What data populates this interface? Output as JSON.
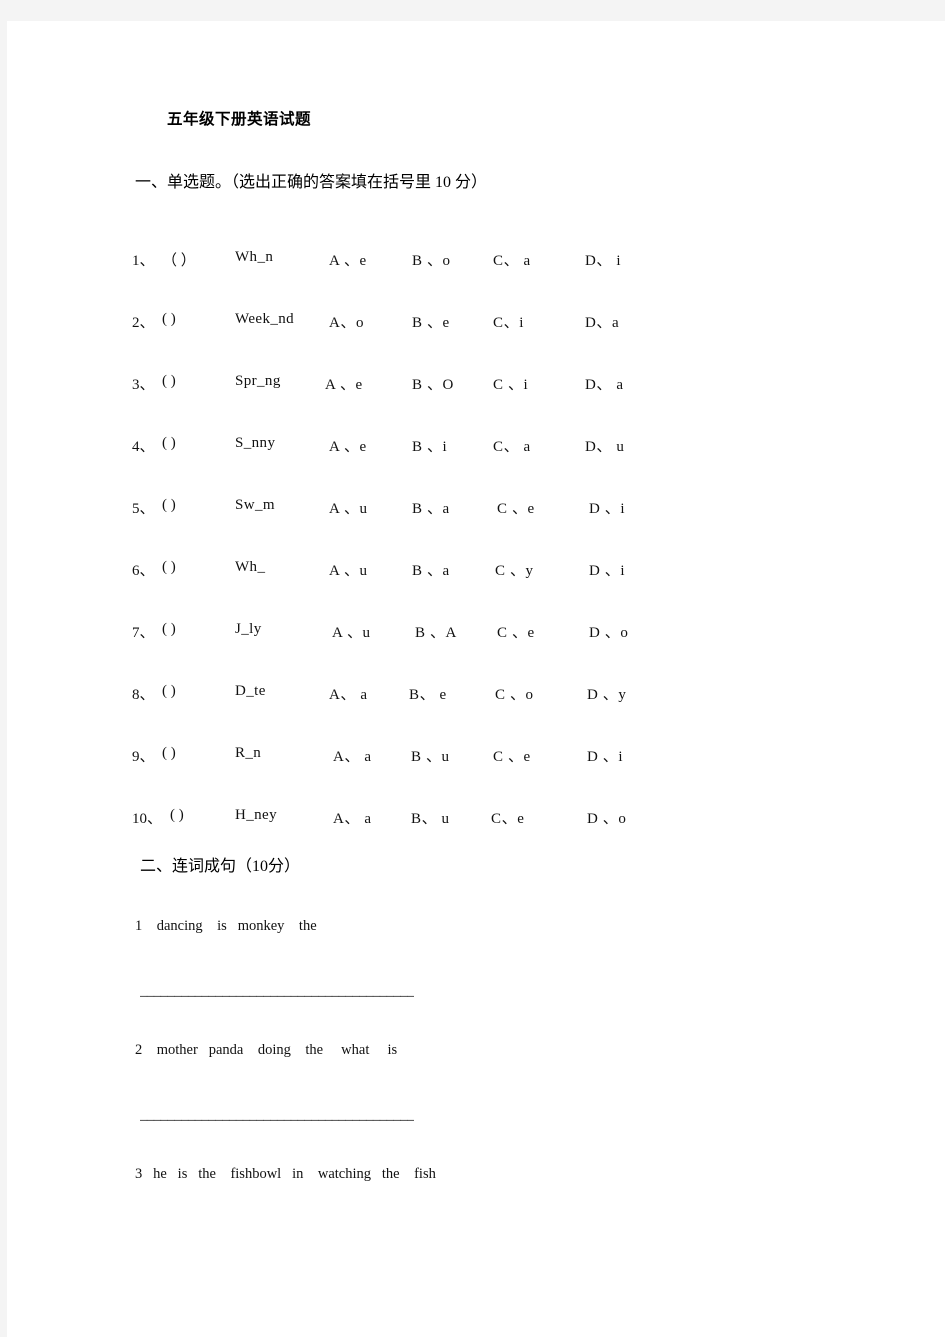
{
  "document": {
    "title": "五年级下册英语试题"
  },
  "sections": [
    {
      "heading": "一、单选题。（选出正确的答案填在括号里 10 分）"
    },
    {
      "heading": "二、连词成句（10分）"
    }
  ],
  "multiple_choice": [
    {
      "no": "1、",
      "paren": "（    ）",
      "word": "Wh_n",
      "a": "A 、e",
      "b": "B 、o",
      "c": "C、 a",
      "d": "D、 i"
    },
    {
      "no": "2、",
      "paren": "(    )",
      "word": "Week_nd",
      "a": "A、o",
      "b": "B 、e",
      "c": "C、i",
      "d": "D、a"
    },
    {
      "no": "3、",
      "paren": "(    )",
      "word": "Spr_ng",
      "a": "A 、e",
      "b": "B 、O",
      "c": "C 、i",
      "d": "D、 a"
    },
    {
      "no": "4、",
      "paren": "(    )",
      "word": "S_nny",
      "a": "A 、e",
      "b": "B 、i",
      "c": "C、 a",
      "d": "D、 u"
    },
    {
      "no": "5、",
      "paren": "(    )",
      "word": "Sw_m",
      "a": "A 、u",
      "b": "B 、a",
      "c": "C 、e",
      "d": "D 、i"
    },
    {
      "no": "6、",
      "paren": "(    )",
      "word": "Wh_",
      "a": "A 、u",
      "b": "B 、a",
      "c": "C 、y",
      "d": "D 、i"
    },
    {
      "no": "7、",
      "paren": "(    )",
      "word": "J_ly",
      "a": "A 、u",
      "b": "B 、A",
      "c": "C 、e",
      "d": "D 、o"
    },
    {
      "no": "8、",
      "paren": "(    )",
      "word": "D_te",
      "a": "A、 a",
      "b": "B、 e",
      "c": "C 、o",
      "d": "D 、y"
    },
    {
      "no": "9、",
      "paren": "(    )",
      "word": "R_n",
      "a": "A、 a",
      "b": "B 、u",
      "c": "C 、e",
      "d": "D 、i"
    },
    {
      "no": "10、",
      "paren": "(    )",
      "word": "H_ney",
      "a": "A、 a",
      "b": "B、  u",
      "c": "C、e",
      "d": "D 、o"
    }
  ],
  "sentence_items": [
    {
      "no": "1",
      "words": "1    dancing    is   monkey    the"
    },
    {
      "no": "2",
      "words": "2    mother   panda    doing    the     what     is"
    },
    {
      "no": "3",
      "words": "3   he   is   the    fishbowl   in    watching   the    fish"
    }
  ],
  "blanks": [
    "________________________________________",
    "________________________________________"
  ]
}
